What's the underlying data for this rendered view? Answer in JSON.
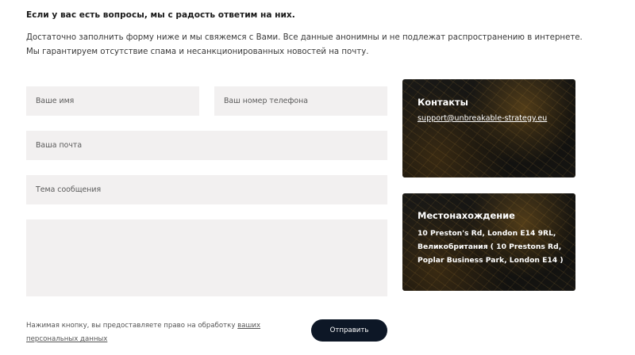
{
  "intro": {
    "heading": "Если у вас есть вопросы, мы с радость ответим на них.",
    "line1": "Достаточно заполнить форму ниже и мы свяжемся с Вами. Все данные анонимны и не подлежат распространению в интернете.",
    "line2": "Мы гарантируем отсутствие спама и несанкционированных новостей на почту."
  },
  "form": {
    "name_placeholder": "Ваше имя",
    "phone_placeholder": "Ваш номер телефона",
    "email_placeholder": "Ваша почта",
    "subject_placeholder": "Тема сообщения",
    "message_placeholder": "",
    "consent_text": "Нажимая кнопку, вы предоставляете право на обработку ",
    "consent_link": "ваших персональных данных",
    "submit_label": "Отправить"
  },
  "contacts": {
    "title": "Контакты",
    "email": "support@unbreakable-strategy.eu"
  },
  "location": {
    "title": "Местонахождение",
    "address": "10 Preston's Rd, London E14 9RL, Великобритания ( 10 Prestons Rd, Poplar Business Park, London E14 )"
  },
  "colors": {
    "field_background": "#f2f0f0",
    "button_background": "#0d1726",
    "card_background": "#141311"
  }
}
